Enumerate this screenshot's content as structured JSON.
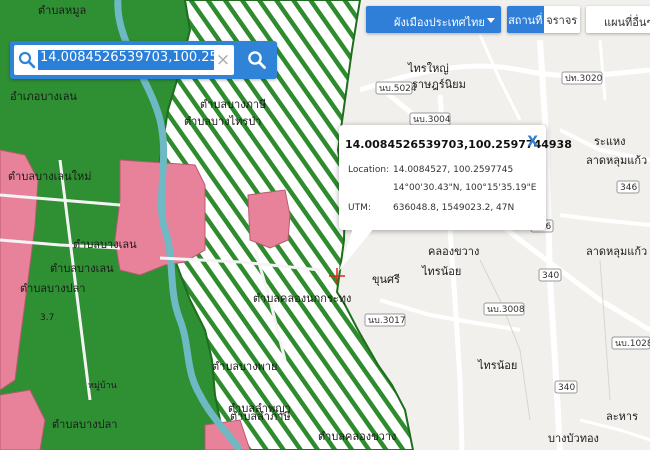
{
  "search": {
    "value": "14.0084526539703,100.2597744938"
  },
  "controls": {
    "layer_dropdown": "ผังเมืองประเทศไทย",
    "tab_places": "สถานที่",
    "tab_traffic": "จราจร",
    "other_maps": "แผนที่อื่นๆ"
  },
  "popup": {
    "title": "14.0084526539703,100.2597744938",
    "close": "X",
    "location_label": "Location:",
    "location_decimal": "14.0084527, 100.2597745",
    "location_dms": "14°00'30.43\"N, 100°15'35.19\"E",
    "utm_label": "UTM:",
    "utm_value": "636048.8, 1549023.2, 47N"
  },
  "map_labels": {
    "l1": "ตำบลหมูล",
    "l2": "อำเภอบางเลน",
    "l3": "ตำบลบางภาษี",
    "l4": "ตำบลบางไทรป่า",
    "l5": "ตำบลบางเลน",
    "l6": "ตำบลคลองนกกระทุง",
    "l7": "ตำบลบางปลา",
    "l8": "ตำบลบางเลนใหม่",
    "l9": "ไทรใหญ่",
    "l10": "ราษฎร์นิยม",
    "l11": "ระแหง",
    "l12": "ลาดหลุมแก้ว",
    "l13": "คลองขวาง",
    "l14": "ไทรน้อย",
    "l15": "ขุนศรี",
    "l16": "ลาดหลุมแก้ว",
    "l17": "ไทรน้อย",
    "l18": "ละหาร",
    "l19": "บางบัวทอง",
    "l20": "ตำบลบางปลา",
    "l21": "ตำบลลำภาษี",
    "l22": "ตำบลคลองขวาง",
    "l23": "3.7",
    "l24": "หมู่บ้าน",
    "l25": "ตำบลบางเลน",
    "l26": "ตำบลลำพญา",
    "l27": "ตำบลบางพาย"
  },
  "road_shields": {
    "r1": "นบ.5024",
    "r2": "ปท.3020",
    "r3": "นบ.3004",
    "r4": "346",
    "r5": "346",
    "r6": "340",
    "r7": "นบ.3008",
    "r8": "นบ.3017",
    "r9": "340",
    "r10": "นบ.1028"
  },
  "colors": {
    "dark_green": "#2f8f33",
    "hatch_green": "#2e8b2e",
    "pink_zone": "#e8829a",
    "river": "#6fb9c5",
    "accent_blue": "#2f84d8",
    "base_map": "#f2f0ec"
  },
  "icons": [
    "search-icon",
    "close-icon",
    "chevron-down-icon",
    "crosshair-marker-icon"
  ]
}
